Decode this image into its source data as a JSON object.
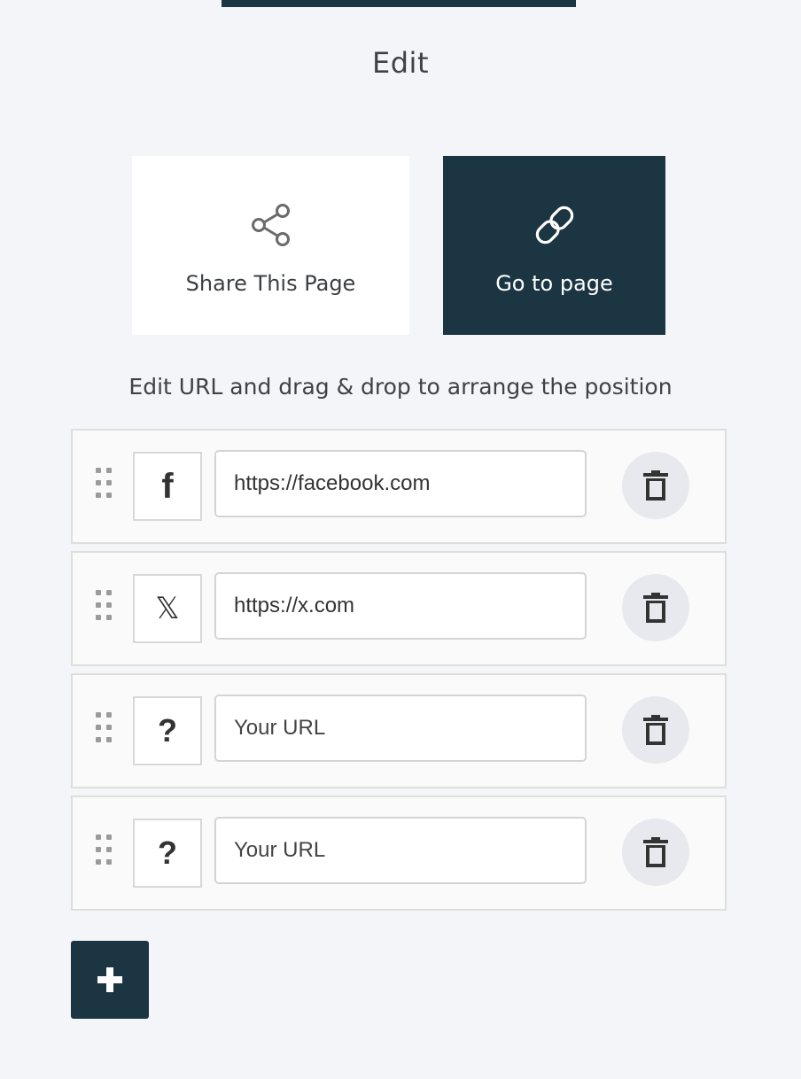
{
  "page": {
    "title": "Edit",
    "accent_color": "#1c3543",
    "background_color": "#f4f5f9"
  },
  "actions": {
    "share": {
      "label": "Share This Page",
      "icon": "share-icon"
    },
    "goto": {
      "label": "Go to page",
      "icon": "link-icon"
    }
  },
  "instructions": "Edit URL and drag & drop to arrange the position",
  "links": [
    {
      "network": "facebook",
      "icon": "facebook-icon",
      "glyph": "f",
      "value": "https://facebook.com",
      "placeholder": "Your URL"
    },
    {
      "network": "x",
      "icon": "x-icon",
      "glyph": "𝕏",
      "value": "https://x.com",
      "placeholder": "Your URL"
    },
    {
      "network": "unknown",
      "icon": "question-icon",
      "glyph": "?",
      "value": "",
      "placeholder": "Your URL"
    },
    {
      "network": "unknown",
      "icon": "question-icon",
      "glyph": "?",
      "value": "",
      "placeholder": "Your URL"
    }
  ],
  "add_button": {
    "icon": "plus-icon"
  }
}
